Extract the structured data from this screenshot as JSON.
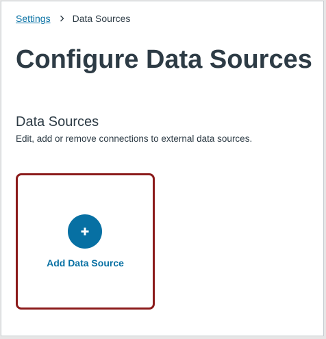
{
  "breadcrumb": {
    "parent": "Settings",
    "current": "Data Sources",
    "separator_icon": "chevron-right-icon"
  },
  "page": {
    "title": "Configure Data Sources"
  },
  "section": {
    "title": "Data Sources",
    "description": "Edit, add or remove connections to external data sources."
  },
  "add_card": {
    "label": "Add Data Source",
    "icon": "plus-icon"
  },
  "colors": {
    "link": "#0770a3",
    "text": "#2d3b45",
    "highlight_border": "#8b1a1a",
    "button_fill": "#0770a3"
  }
}
